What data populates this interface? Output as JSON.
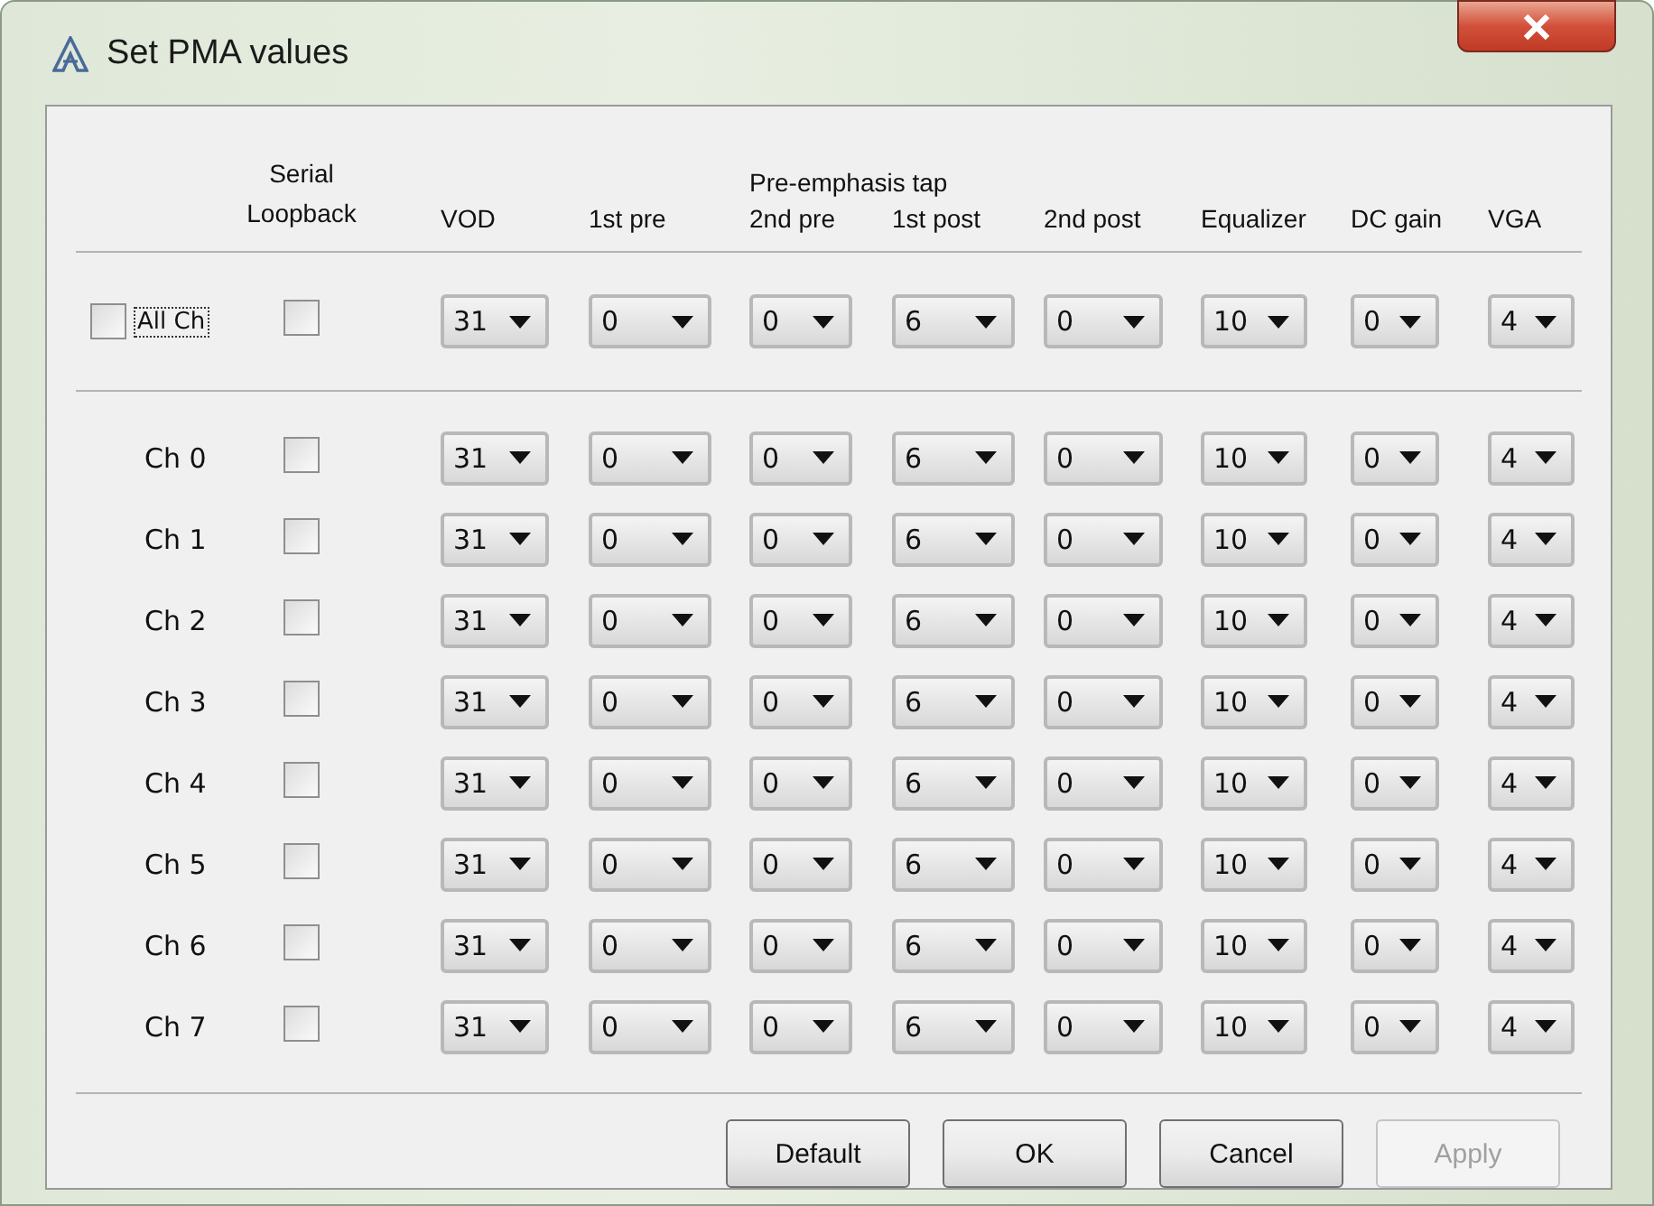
{
  "window": {
    "title": "Set PMA values"
  },
  "group_header": "Pre-emphasis tap",
  "serial_header": "Serial Loopback",
  "columns": [
    {
      "label": "VOD"
    },
    {
      "label": "1st pre"
    },
    {
      "label": "2nd pre"
    },
    {
      "label": "1st post"
    },
    {
      "label": "2nd post"
    },
    {
      "label": "Equalizer"
    },
    {
      "label": "DC gain"
    },
    {
      "label": "VGA"
    }
  ],
  "all_row": {
    "label": "All Ch",
    "checked": false,
    "focused": true,
    "loopback": false,
    "values": [
      "31",
      "0",
      "0",
      "6",
      "0",
      "10",
      "0",
      "4"
    ]
  },
  "channels": [
    {
      "label": "Ch 0",
      "loopback": false,
      "values": [
        "31",
        "0",
        "0",
        "6",
        "0",
        "10",
        "0",
        "4"
      ]
    },
    {
      "label": "Ch 1",
      "loopback": false,
      "values": [
        "31",
        "0",
        "0",
        "6",
        "0",
        "10",
        "0",
        "4"
      ]
    },
    {
      "label": "Ch 2",
      "loopback": false,
      "values": [
        "31",
        "0",
        "0",
        "6",
        "0",
        "10",
        "0",
        "4"
      ]
    },
    {
      "label": "Ch 3",
      "loopback": false,
      "values": [
        "31",
        "0",
        "0",
        "6",
        "0",
        "10",
        "0",
        "4"
      ]
    },
    {
      "label": "Ch 4",
      "loopback": false,
      "values": [
        "31",
        "0",
        "0",
        "6",
        "0",
        "10",
        "0",
        "4"
      ]
    },
    {
      "label": "Ch 5",
      "loopback": false,
      "values": [
        "31",
        "0",
        "0",
        "6",
        "0",
        "10",
        "0",
        "4"
      ]
    },
    {
      "label": "Ch 6",
      "loopback": false,
      "values": [
        "31",
        "0",
        "0",
        "6",
        "0",
        "10",
        "0",
        "4"
      ]
    },
    {
      "label": "Ch 7",
      "loopback": false,
      "values": [
        "31",
        "0",
        "0",
        "6",
        "0",
        "10",
        "0",
        "4"
      ]
    }
  ],
  "buttons": [
    {
      "label": "Default",
      "disabled": false
    },
    {
      "label": "OK",
      "disabled": false
    },
    {
      "label": "Cancel",
      "disabled": false
    },
    {
      "label": "Apply",
      "disabled": true
    }
  ]
}
